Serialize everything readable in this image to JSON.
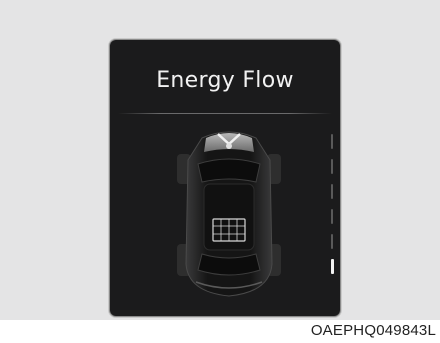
{
  "screen": {
    "title": "Energy Flow"
  },
  "battery_gauge": {
    "segments_total": 6,
    "segments_lit": 1,
    "level_fraction": 0.17
  },
  "caption": "OAEPHQ049843L",
  "colors": {
    "screen_bg": "#1b1b1c",
    "panel_bg": "#e4e4e5",
    "text": "#f2f2f2"
  }
}
